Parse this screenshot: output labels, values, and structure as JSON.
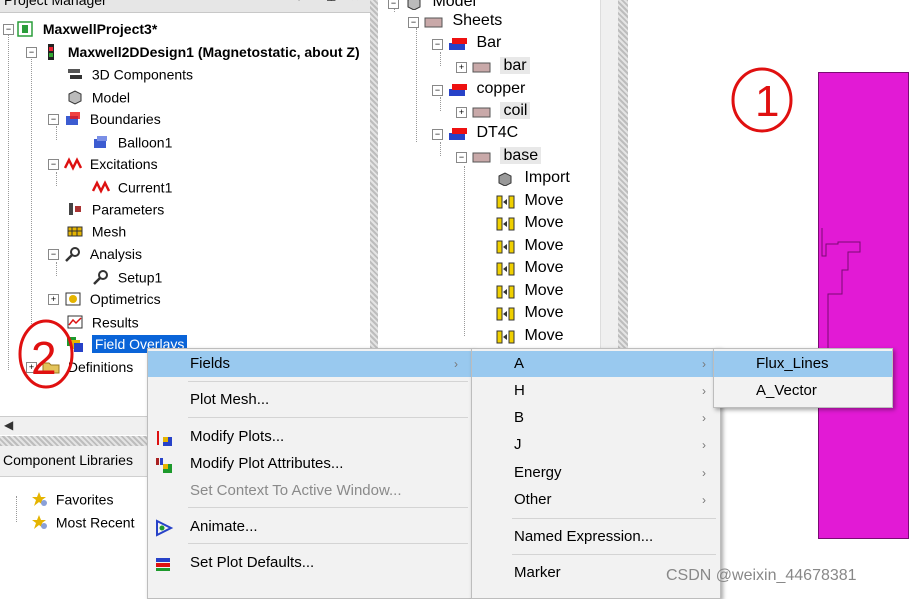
{
  "project_manager": {
    "title": "Project Manager",
    "tree": [
      {
        "label": "MaxwellProject3*",
        "bold": true
      },
      {
        "label": "Maxwell2DDesign1 (Magnetostatic, about Z)",
        "bold": true
      },
      {
        "label": "3D Components"
      },
      {
        "label": "Model"
      },
      {
        "label": "Boundaries"
      },
      {
        "label": "Balloon1"
      },
      {
        "label": "Excitations"
      },
      {
        "label": "Current1"
      },
      {
        "label": "Parameters"
      },
      {
        "label": "Mesh"
      },
      {
        "label": "Analysis"
      },
      {
        "label": "Setup1"
      },
      {
        "label": "Optimetrics"
      },
      {
        "label": "Results"
      },
      {
        "label": "Field Overlays"
      },
      {
        "label": "Definitions"
      }
    ]
  },
  "component_libraries": {
    "title": "Component Libraries",
    "items": [
      {
        "label": "Favorites"
      },
      {
        "label": "Most Recent"
      }
    ]
  },
  "model_tree": {
    "items": [
      {
        "label": "Model"
      },
      {
        "label": "Sheets"
      },
      {
        "label": "Bar"
      },
      {
        "label": "bar"
      },
      {
        "label": "copper"
      },
      {
        "label": "coil"
      },
      {
        "label": "DT4C"
      },
      {
        "label": "base"
      },
      {
        "label": "Import"
      },
      {
        "label": "Move"
      },
      {
        "label": "Move"
      },
      {
        "label": "Move"
      },
      {
        "label": "Move"
      },
      {
        "label": "Move"
      },
      {
        "label": "Move"
      },
      {
        "label": "Move"
      }
    ]
  },
  "context_menu": {
    "items": [
      {
        "label": "Fields",
        "submenu": true
      },
      {
        "label": "Plot Mesh..."
      },
      {
        "label": "Modify Plots..."
      },
      {
        "label": "Modify Plot Attributes..."
      },
      {
        "label": "Set Context To Active Window...",
        "disabled": true
      },
      {
        "label": "Animate..."
      },
      {
        "label": "Set Plot Defaults..."
      }
    ]
  },
  "fields_submenu": {
    "items": [
      {
        "label": "A"
      },
      {
        "label": "H"
      },
      {
        "label": "B"
      },
      {
        "label": "J"
      },
      {
        "label": "Energy"
      },
      {
        "label": "Other"
      },
      {
        "label": "Named Expression..."
      },
      {
        "label": "Marker"
      }
    ]
  },
  "a_submenu": {
    "items": [
      {
        "label": "Flux_Lines"
      },
      {
        "label": "A_Vector"
      }
    ]
  },
  "annotations": {
    "circle_1": "1",
    "circle_2": "2"
  },
  "watermark": "CSDN @weixin_44678381",
  "colors": {
    "highlight": "#99c9ef",
    "selection": "#0a64d8",
    "solid": "#e21ad5",
    "annotation": "#e01010"
  }
}
